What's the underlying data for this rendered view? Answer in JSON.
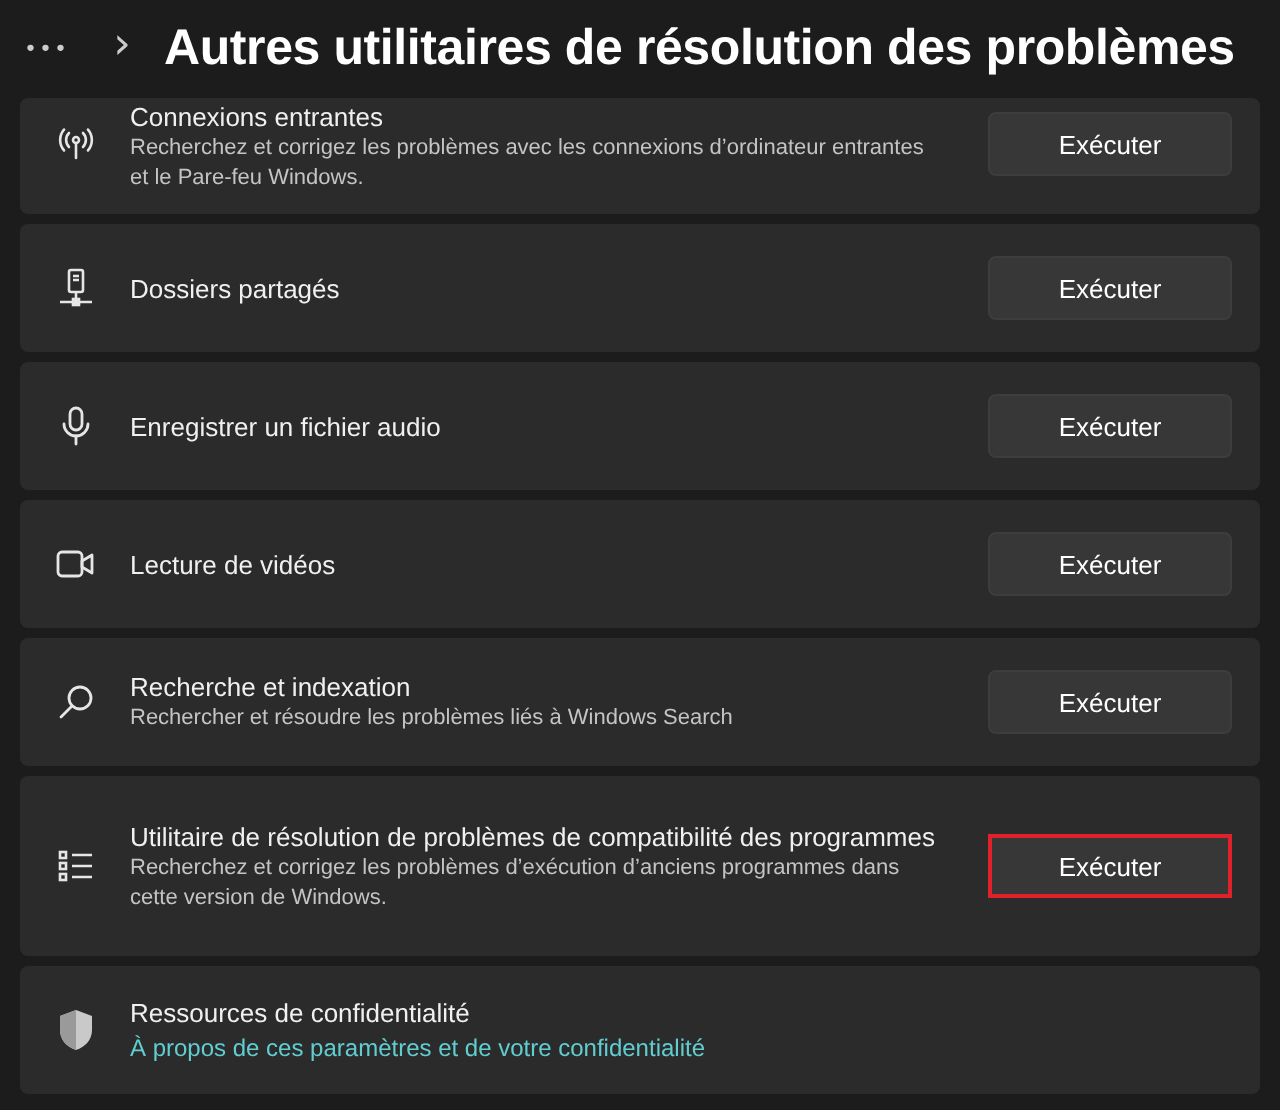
{
  "header": {
    "more": "•••",
    "chevron": "›",
    "title": "Autres utilitaires de résolution des problèmes"
  },
  "items": [
    {
      "kind": "runner",
      "title": "Connexions entrantes",
      "description": "Recherchez et corrigez les problèmes avec les connexions d’ordinateur entrantes et le Pare-feu Windows.",
      "button": "Exécuter",
      "highlighted": false
    },
    {
      "kind": "runner",
      "title": "Dossiers partagés",
      "button": "Exécuter",
      "highlighted": false
    },
    {
      "kind": "runner",
      "title": "Enregistrer un fichier audio",
      "button": "Exécuter",
      "highlighted": false
    },
    {
      "kind": "runner",
      "title": "Lecture de vidéos",
      "button": "Exécuter",
      "highlighted": false
    },
    {
      "kind": "runner",
      "title": "Recherche et indexation",
      "description": "Rechercher et résoudre les problèmes liés à Windows Search",
      "button": "Exécuter",
      "highlighted": false
    },
    {
      "kind": "runner",
      "title": "Utilitaire de résolution de problèmes de compatibilité des programmes",
      "description": "Recherchez et corrigez les problèmes d’exécution d’anciens programmes dans cette version de Windows.",
      "button": "Exécuter",
      "highlighted": true
    },
    {
      "kind": "link",
      "title": "Ressources de confidentialité",
      "link": "À propos de ces paramètres et de votre confidentialité"
    }
  ]
}
